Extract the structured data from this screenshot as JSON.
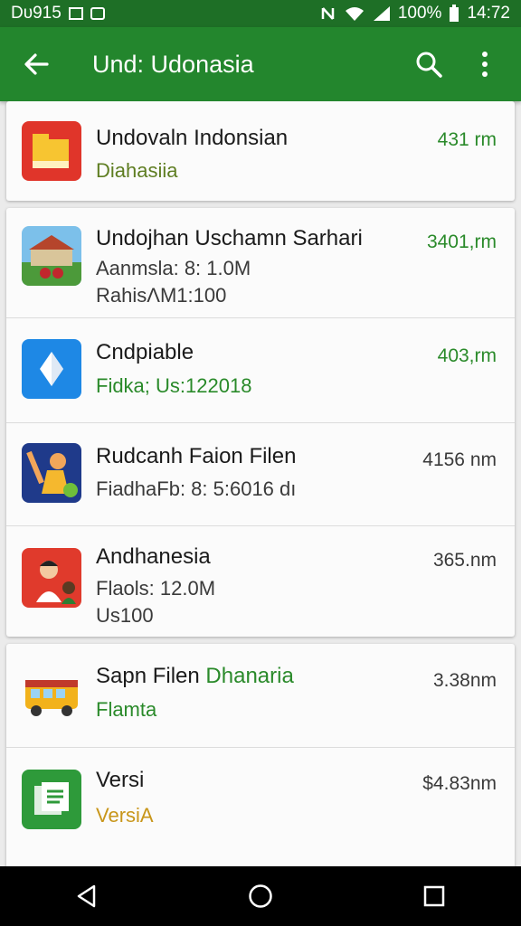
{
  "status_bar": {
    "left_text": "Dᴜ915",
    "battery": "100%",
    "time": "14:72"
  },
  "app_bar": {
    "title": "Und: Udonasia",
    "icons": [
      "back-arrow-icon",
      "search-icon",
      "more-vert-icon"
    ]
  },
  "colors": {
    "app_bar": "#23862d",
    "status_bar": "#1e6f26",
    "accent_green": "#2a8a2a",
    "nav_bar": "#000000"
  },
  "cards": [
    {
      "items": [
        {
          "title": "Undovaln Indonsian",
          "subs": [
            "Diahasiia"
          ],
          "size": "431 rm",
          "icon": "folder-icon"
        }
      ]
    },
    {
      "items": [
        {
          "title": "Undojhan Uschamn Sarhari",
          "subs": [
            "Aanmsla: 8: 1.0M",
            "RahisΛM1:100"
          ],
          "size": "3401,rm",
          "icon": "landscape-icon"
        },
        {
          "title": "Cndpiable",
          "subs": [
            "Fidka; Us:122018"
          ],
          "size": "403,rm",
          "icon": "compass-icon"
        },
        {
          "title": "Rudcanh Faion Filen",
          "subs": [
            "FiadhaFb: 8: 5:6016 dı"
          ],
          "size": "4156 nm",
          "icon": "cartoon-figure-icon"
        },
        {
          "title": "Andhanesia",
          "subs": [
            "Flaols: 12.0M",
            "Us100"
          ],
          "size": "365.nm",
          "icon": "people-icon"
        }
      ]
    },
    {
      "items": [
        {
          "title": "Sapn Filen",
          "title_extra": "Dhanaria",
          "subs": [
            "Flamta"
          ],
          "size": "3.38nm",
          "icon": "bus-icon"
        },
        {
          "title": "Versi",
          "subs": [
            "VersiA"
          ],
          "size": "$4.83nm",
          "icon": "document-icon"
        }
      ]
    }
  ],
  "nav_bar": {
    "buttons": [
      "back-triangle-icon",
      "home-circle-icon",
      "recents-square-icon"
    ]
  }
}
